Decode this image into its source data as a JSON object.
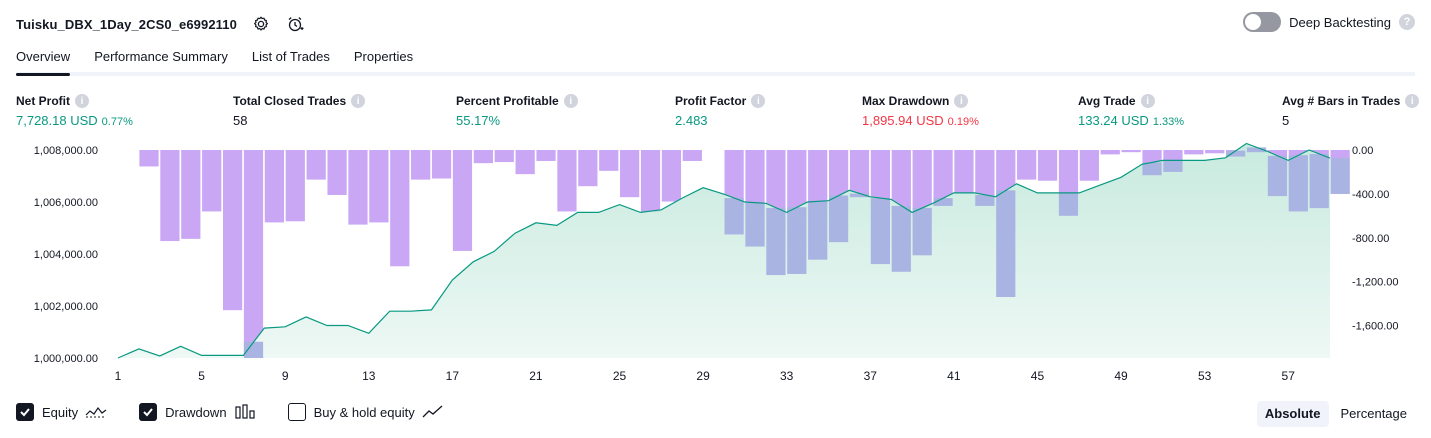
{
  "header": {
    "strategy_name": "Tuisku_DBX_1Day_2CS0_e6992110",
    "settings_icon": "gear-icon",
    "alert_icon": "alarm-clock-plus-icon",
    "deep_backtesting_label": "Deep Backtesting",
    "deep_backtesting_enabled": false,
    "help_icon": "?"
  },
  "tabs": [
    {
      "label": "Overview",
      "active": true
    },
    {
      "label": "Performance Summary",
      "active": false
    },
    {
      "label": "List of Trades",
      "active": false
    },
    {
      "label": "Properties",
      "active": false
    }
  ],
  "metrics": [
    {
      "label": "Net Profit",
      "value": "7,728.18 USD",
      "sub": "0.77%",
      "color": "#089981"
    },
    {
      "label": "Total Closed Trades",
      "value": "58",
      "sub": "",
      "color": "#131722"
    },
    {
      "label": "Percent Profitable",
      "value": "55.17%",
      "sub": "",
      "color": "#089981"
    },
    {
      "label": "Profit Factor",
      "value": "2.483",
      "sub": "",
      "color": "#089981"
    },
    {
      "label": "Max Drawdown",
      "value": "1,895.94 USD",
      "sub": "0.19%",
      "color": "#f23645"
    },
    {
      "label": "Avg Trade",
      "value": "133.24 USD",
      "sub": "1.33%",
      "color": "#089981"
    },
    {
      "label": "Avg # Bars in Trades",
      "value": "5",
      "sub": "",
      "color": "#131722"
    }
  ],
  "metric_info_icon": "i",
  "legend": {
    "equity_label": "Equity",
    "equity_checked": true,
    "drawdown_label": "Drawdown",
    "drawdown_checked": true,
    "buyhold_label": "Buy & hold equity",
    "buyhold_checked": false
  },
  "modes": {
    "absolute_label": "Absolute",
    "percentage_label": "Percentage",
    "active": "absolute"
  },
  "chart_data": {
    "type": "line",
    "x": [
      1,
      2,
      3,
      4,
      5,
      6,
      7,
      8,
      9,
      10,
      11,
      12,
      13,
      14,
      15,
      16,
      17,
      18,
      19,
      20,
      21,
      22,
      23,
      24,
      25,
      26,
      27,
      28,
      29,
      30,
      31,
      32,
      33,
      34,
      35,
      36,
      37,
      38,
      39,
      40,
      41,
      42,
      43,
      44,
      45,
      46,
      47,
      48,
      49,
      50,
      51,
      52,
      53,
      54,
      55,
      56,
      57,
      58,
      59
    ],
    "x_ticks": [
      "1",
      "5",
      "9",
      "13",
      "17",
      "21",
      "25",
      "29",
      "33",
      "37",
      "41",
      "45",
      "49",
      "53",
      "57"
    ],
    "left_axis": {
      "ticks": [
        "1,008,000.00",
        "1,006,000.00",
        "1,004,000.00",
        "1,002,000.00",
        "1,000,000.00"
      ],
      "ylim": [
        1000000,
        1008000
      ]
    },
    "right_axis": {
      "ticks": [
        "0.00",
        "-400.00",
        "-800.00",
        "-1,200.00",
        "-1,600.00"
      ],
      "ylim": [
        -1896,
        0
      ]
    },
    "series": [
      {
        "name": "Equity",
        "color": "#089981",
        "fill": "#d7f0ea",
        "values": [
          1000000,
          1000350,
          1000080,
          1000450,
          1000100,
          1000100,
          1000100,
          1001150,
          1001200,
          1001580,
          1001250,
          1001250,
          1000950,
          1001800,
          1001800,
          1001850,
          1003000,
          1003700,
          1004100,
          1004800,
          1005200,
          1005100,
          1005600,
          1005600,
          1005900,
          1005600,
          1005700,
          1006150,
          1006550,
          1006300,
          1006000,
          1005950,
          1005600,
          1006000,
          1006050,
          1006450,
          1006200,
          1006100,
          1005600,
          1005950,
          1006350,
          1006350,
          1006200,
          1006700,
          1006350,
          1006350,
          1006350,
          1006650,
          1006950,
          1007450,
          1007600,
          1007600,
          1007600,
          1007700,
          1008250,
          1007950,
          1007600,
          1008000,
          1007690
        ]
      },
      {
        "name": "Drawdown",
        "color": "#c9a7f5",
        "overlap_color": "#aab4e2",
        "values": [
          0,
          -150,
          -830,
          -810,
          -560,
          -1460,
          -1896,
          -660,
          -650,
          -270,
          -410,
          -680,
          -660,
          -1060,
          -270,
          -260,
          -920,
          -120,
          -110,
          -220,
          -100,
          -560,
          -330,
          -190,
          -430,
          -560,
          -470,
          -100,
          0,
          -770,
          -880,
          -1140,
          -1130,
          -1000,
          -840,
          -430,
          -1040,
          -1110,
          -960,
          -510,
          -390,
          -510,
          -1340,
          -270,
          -280,
          -600,
          -280,
          -40,
          -20,
          -230,
          -200,
          -40,
          -30,
          -60,
          -20,
          -420,
          -560,
          -530,
          -400
        ]
      }
    ],
    "grid": false,
    "legend": "bottom-left"
  }
}
